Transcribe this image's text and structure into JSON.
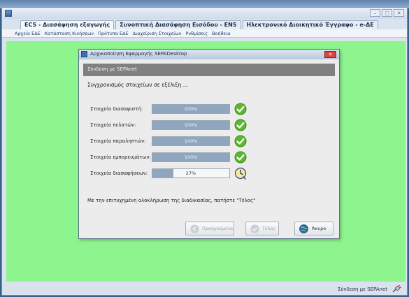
{
  "window": {
    "controls": [
      "–",
      "□",
      "✕"
    ]
  },
  "tabs": [
    {
      "label": "ECS - Διασάφηση εξαγωγής",
      "active": true
    },
    {
      "label": "Συνοπτική Διασάφηση Εισόδου - ENS",
      "active": false
    },
    {
      "label": "Ηλεκτρονικό Διοικητικό Έγγραφο - e-ΔΕ",
      "active": false
    }
  ],
  "menu": [
    "Αρχείο ΕΔΕ",
    "Κατάσταση Κινήσεων",
    "Πρότυπα ΕΔΕ",
    "Διαχείριση Στοιχείων",
    "Ρυθμίσεις",
    "Βοήθεια"
  ],
  "statusbar": {
    "connection_label": "Σύνδεση με SEPAnet"
  },
  "dialog": {
    "title": "Αρχικοποίηση Εφαρμογής SEPADesktop",
    "close_label": "✕",
    "header": "Σύνδεση με SEPAnet",
    "sync_text": "Συγχρονισμός στοιχείων σε εξέλιξη ...",
    "rows": [
      {
        "label": "Στοιχεία διασαφιστή:",
        "progress": 100,
        "progress_text": "100%",
        "status": "check-icon"
      },
      {
        "label": "Στοιχεία πελατών:",
        "progress": 100,
        "progress_text": "100%",
        "status": "check-icon"
      },
      {
        "label": "Στοιχεία παραληπτών:",
        "progress": 100,
        "progress_text": "100%",
        "status": "check-icon"
      },
      {
        "label": "Στοιχεία εμπορευμάτων:",
        "progress": 100,
        "progress_text": "100%",
        "status": "check-icon"
      },
      {
        "label": "Στοιχεία διασαφήσεων:",
        "progress": 27,
        "progress_text": "27%",
        "status": "clock-icon"
      }
    ],
    "finish_note": "Με την επιτυχημένη ολοκλήρωση της διαδικασίας, πατήστε \"Τέλος\"",
    "buttons": {
      "previous": "Προηγούμενο",
      "finish": "Τέλος",
      "cancel": "Άκυρο"
    }
  },
  "colors": {
    "content_bg": "#8ef58e",
    "progress_fill": "#8fa6be",
    "check_green": "#5cb82e",
    "header_gray": "#808080"
  }
}
